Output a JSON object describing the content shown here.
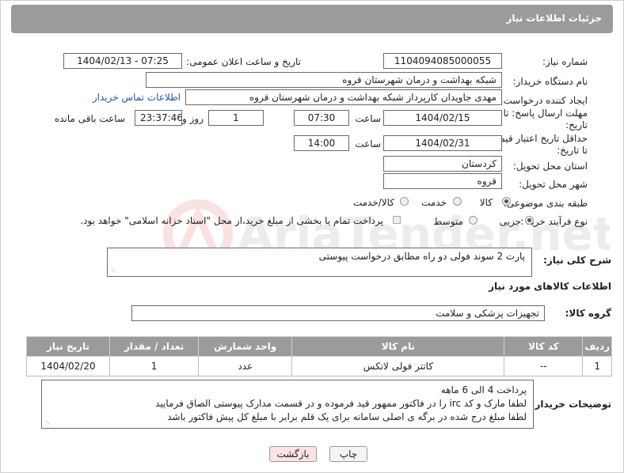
{
  "header": {
    "title": "جزئیات اطلاعات نیاز"
  },
  "fields": {
    "need_number_label": "شماره نیاز:",
    "need_number": "1104094085000055",
    "announce_label": "تاریخ و ساعت اعلان عمومی:",
    "announce_value": "1404/02/13 - 07:25",
    "buyer_org_label": "نام دستگاه خریدار:",
    "buyer_org": "شبکه بهداشت و درمان شهرستان قروه",
    "creator_label": "ایجاد کننده درخواست:",
    "creator": "مهدی جاویدان کارپرداز شبکه بهداشت و درمان شهرستان قروه",
    "contact_link": "اطلاعات تماس خریدار",
    "deadline_label": "مهلت ارسال پاسخ: تا تاریخ:",
    "deadline_date": "1404/02/15",
    "time_label": "ساعت",
    "deadline_time": "07:30",
    "days_value": "1",
    "days_label": "روز و",
    "remaining_time": "23:37:46",
    "remaining_label": "ساعت باقی مانده",
    "validity_label": "حداقل تاریخ اعتبار قیمت: تا تاریخ:",
    "validity_date": "1404/02/31",
    "validity_time": "14:00",
    "province_label": "استان محل تحویل:",
    "province": "کردستان",
    "city_label": "شهر محل تحویل:",
    "city": "قروه",
    "category_label": "طبقه بندی موضوعی:",
    "cat_goods": "کالا",
    "cat_service": "خدمت",
    "cat_goods_service": "کالا/خدمت",
    "process_label": "نوع فرآیند خرید :",
    "proc_minor": "جزیی",
    "proc_medium": "متوسط",
    "proc_note": "پرداخت تمام یا بخشی از مبلغ خرید،از محل \"اسناد خزانه اسلامی\" خواهد بود."
  },
  "description": {
    "label": "شرح کلی نیاز:",
    "text": "پارت 2 سوند فولی دو راه مطابق درخواست پیوستی"
  },
  "goods_info": {
    "title": "اطلاعات کالاهای مورد نیاز",
    "group_label": "گروه کالا:",
    "group_value": "تجهیزات پزشکی و سلامت"
  },
  "table": {
    "headers": [
      "ردیف",
      "کد کالا",
      "نام کالا",
      "واحد شمارش",
      "تعداد / مقدار",
      "تاریخ نیاز"
    ],
    "rows": [
      [
        "1",
        "--",
        "کاتتر فولی لاتکس",
        "عدد",
        "1",
        "1404/02/20"
      ]
    ]
  },
  "buyer_notes": {
    "label": "توضیحات خریدار:",
    "lines": [
      "پرداخت 4 الی 6 ماهه",
      "لطفا مارک و کد irc  را در فاکتور ممهور قید فرموده و در قسمت مدارک پیوستی الصاق فرمایید",
      "لطفا مبلغ درج شده در برگه ی اصلی سامانه برای یک قلم برابر با مبلغ کل پیش فاکتور باشد"
    ]
  },
  "buttons": {
    "print": "چاپ",
    "back": "بازگشت"
  },
  "colors": {
    "header_bg": "#9b9b9b",
    "link": "#2255aa",
    "back_btn_bg": "#fbe3e3"
  }
}
